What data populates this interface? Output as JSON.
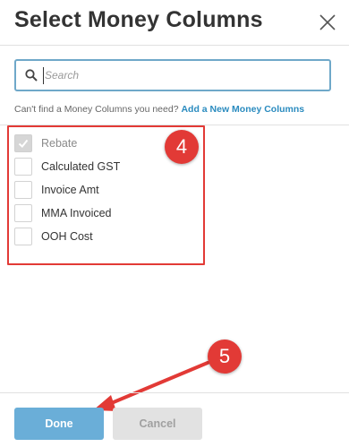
{
  "dialog": {
    "title": "Select Money Columns",
    "search": {
      "placeholder": "Search",
      "value": ""
    },
    "hint_text": "Can't find a Money Columns you need?",
    "hint_link": "Add a New Money Columns",
    "columns": [
      {
        "label": "Rebate",
        "checked": true,
        "disabled": true
      },
      {
        "label": "Calculated GST",
        "checked": false
      },
      {
        "label": "Invoice Amt",
        "checked": false
      },
      {
        "label": "MMA Invoiced",
        "checked": false
      },
      {
        "label": "OOH Cost",
        "checked": false
      }
    ],
    "done_label": "Done",
    "cancel_label": "Cancel"
  },
  "annotations": {
    "step_4": "4",
    "step_5": "5"
  },
  "colors": {
    "accent": "#6aaed8",
    "link": "#2a8bbf",
    "annotation_red": "#e23a36"
  }
}
